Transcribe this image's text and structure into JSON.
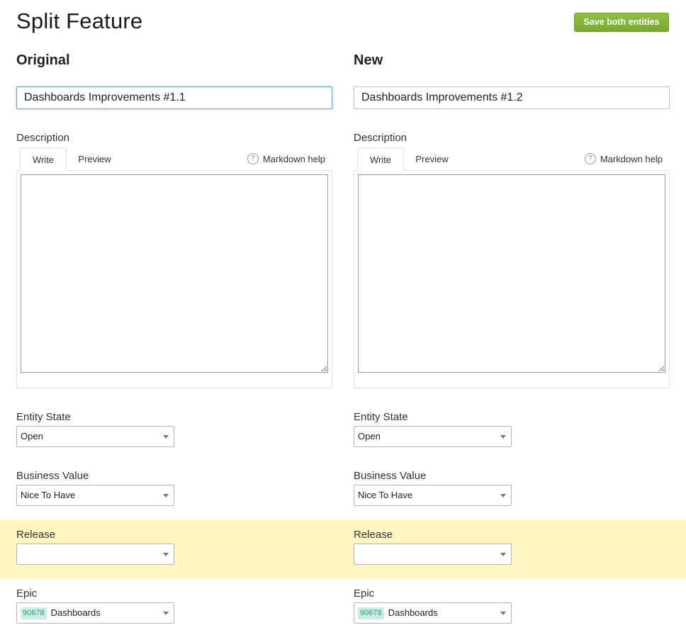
{
  "page": {
    "title": "Split Feature",
    "save_label": "Save both entities"
  },
  "colors": {
    "save_button": "#7fb235",
    "highlight_band": "#fff6c1",
    "focus_border": "#6aa7d8",
    "badge_bg": "#c5f1e6"
  },
  "original": {
    "heading": "Original",
    "name_value": "Dashboards Improvements #1.1",
    "description": {
      "label": "Description",
      "tab_write": "Write",
      "tab_preview": "Preview",
      "markdown_help": "Markdown help",
      "help_icon_glyph": "?",
      "text": ""
    },
    "entity_state": {
      "label": "Entity State",
      "value": "Open"
    },
    "business_value": {
      "label": "Business Value",
      "value": "Nice To Have"
    },
    "release": {
      "label": "Release",
      "value": ""
    },
    "epic": {
      "label": "Epic",
      "id": "90678",
      "value": "Dashboards"
    }
  },
  "new": {
    "heading": "New",
    "name_value": "Dashboards Improvements #1.2",
    "description": {
      "label": "Description",
      "tab_write": "Write",
      "tab_preview": "Preview",
      "markdown_help": "Markdown help",
      "help_icon_glyph": "?",
      "text": ""
    },
    "entity_state": {
      "label": "Entity State",
      "value": "Open"
    },
    "business_value": {
      "label": "Business Value",
      "value": "Nice To Have"
    },
    "release": {
      "label": "Release",
      "value": ""
    },
    "epic": {
      "label": "Epic",
      "id": "90678",
      "value": "Dashboards"
    }
  }
}
